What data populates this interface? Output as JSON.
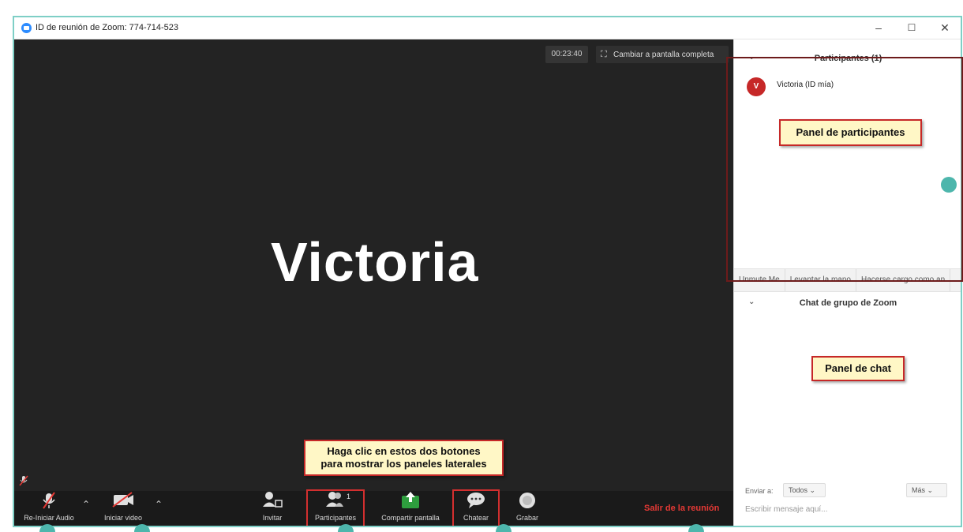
{
  "window": {
    "title": "ID de reunión de Zoom: 774-714-523",
    "minimize": "–",
    "maximize": "☐",
    "close": "✕"
  },
  "video": {
    "timer": "00:23:40",
    "fullscreen_label": "Cambiar a pantalla completa",
    "participant_name": "Victoria"
  },
  "toolbar": {
    "audio_label": "Re-Iniciar Audio",
    "video_label": "Iniciar video",
    "invite_label": "Invitar",
    "participants_label": "Participantes",
    "participants_count": "1",
    "share_label": "Compartir pantalla",
    "chat_label": "Chatear",
    "record_label": "Grabar",
    "leave_label": "Salir de la reunión",
    "caret": "⌃"
  },
  "participants_panel": {
    "title": "Participantes (1)",
    "participant": {
      "initial": "V",
      "name": "Victoria (ID mía)"
    },
    "actions": [
      "Unmute Me",
      "Levantar la mano",
      "Hacerse cargo como an"
    ]
  },
  "chat_panel": {
    "title": "Chat de grupo de Zoom",
    "send_to_label": "Enviar a:",
    "send_to_value": "Todos",
    "more_label": "Más",
    "input_placeholder": "Escribir mensaje aquí..."
  },
  "callouts": {
    "participants_panel": "Panel de participantes",
    "chat_panel": "Panel de chat",
    "click_line1": "Haga clic en estos dos botones",
    "click_line2": "para mostrar los paneles laterales"
  },
  "icons": {
    "zoom": "zoom-logo-icon",
    "mic": "mic-muted-icon",
    "camera": "camera-off-icon",
    "invite": "invite-icon",
    "participants": "participants-icon",
    "share": "share-screen-icon",
    "chat": "chat-bubble-icon",
    "record": "record-icon"
  },
  "colors": {
    "video_bg": "#232323",
    "toolbar_bg": "#1a1a1a",
    "leave_red": "#e53935",
    "highlight_red": "#d32f2f",
    "callout_bg": "#fff7c6",
    "accent_teal": "#4db6ac",
    "share_green": "#2e9e3e",
    "avatar_red": "#c62828"
  }
}
